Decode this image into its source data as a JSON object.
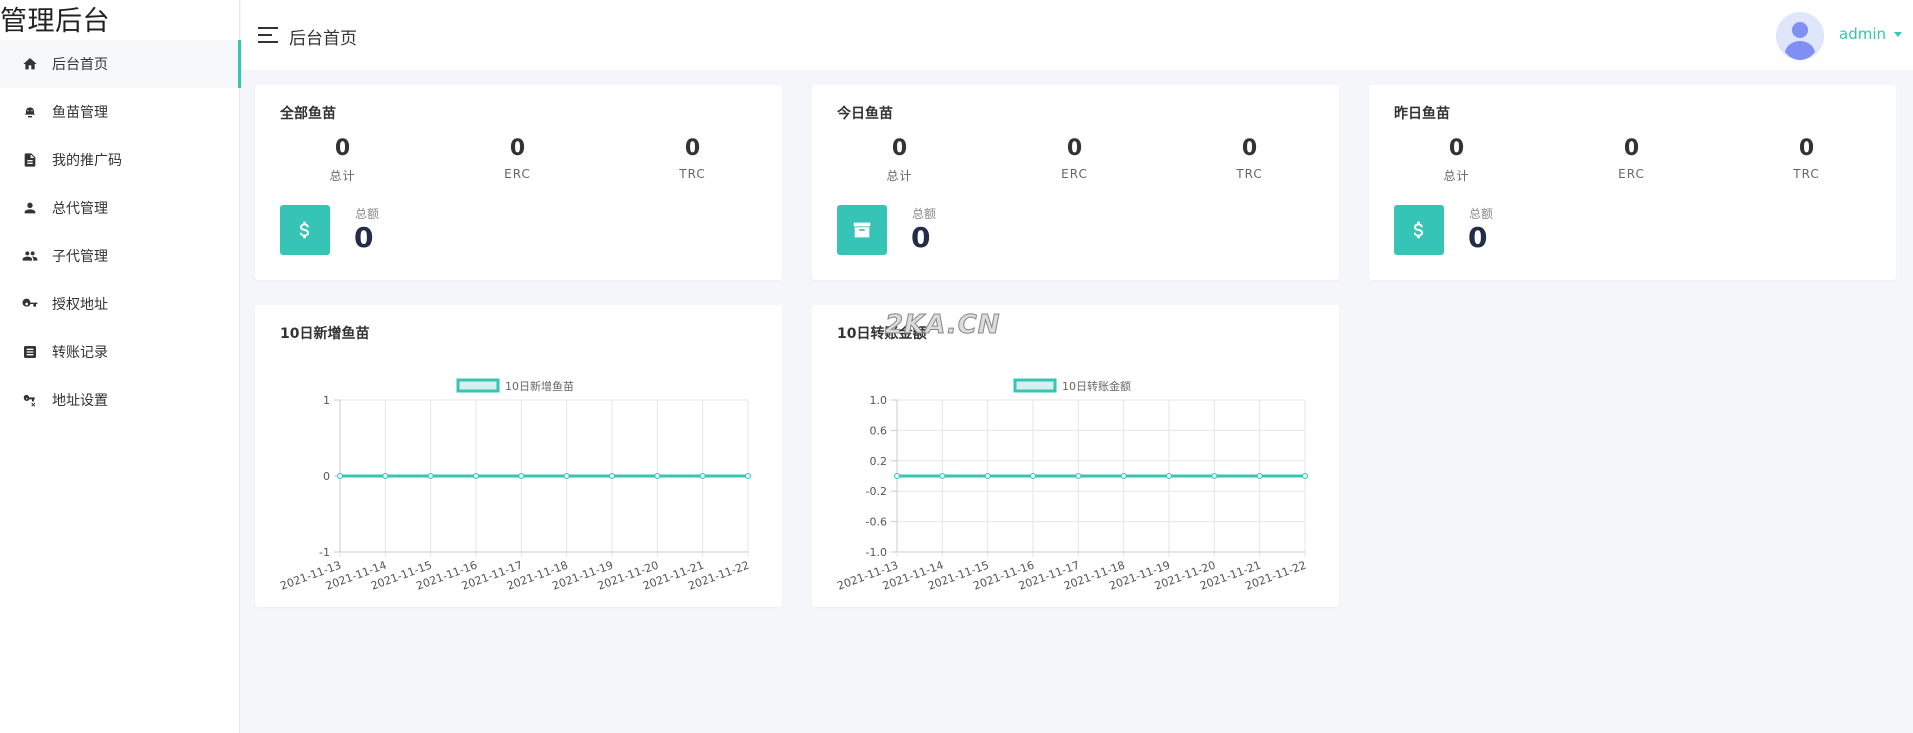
{
  "brand": "管理后台",
  "sidebar": {
    "items": [
      {
        "label": "后台首页",
        "icon": "home-icon",
        "active": true
      },
      {
        "label": "鱼苗管理",
        "icon": "fish-icon",
        "active": false
      },
      {
        "label": "我的推广码",
        "icon": "document-icon",
        "active": false
      },
      {
        "label": "总代管理",
        "icon": "person-icon",
        "active": false
      },
      {
        "label": "子代管理",
        "icon": "people-icon",
        "active": false
      },
      {
        "label": "授权地址",
        "icon": "key-icon",
        "active": false
      },
      {
        "label": "转账记录",
        "icon": "list-icon",
        "active": false
      },
      {
        "label": "地址设置",
        "icon": "key-settings-icon",
        "active": false
      }
    ]
  },
  "header": {
    "title": "后台首页",
    "user": "admin"
  },
  "accent": "#35c4b5",
  "stats": [
    {
      "title": "全部鱼苗",
      "cols": [
        {
          "value": "0",
          "label": "总计"
        },
        {
          "value": "0",
          "label": "ERC"
        },
        {
          "value": "0",
          "label": "TRC"
        }
      ],
      "icon": "dollar-icon",
      "total_label": "总额",
      "total_value": "0"
    },
    {
      "title": "今日鱼苗",
      "cols": [
        {
          "value": "0",
          "label": "总计"
        },
        {
          "value": "0",
          "label": "ERC"
        },
        {
          "value": "0",
          "label": "TRC"
        }
      ],
      "icon": "archive-icon",
      "total_label": "总额",
      "total_value": "0"
    },
    {
      "title": "昨日鱼苗",
      "cols": [
        {
          "value": "0",
          "label": "总计"
        },
        {
          "value": "0",
          "label": "ERC"
        },
        {
          "value": "0",
          "label": "TRC"
        }
      ],
      "icon": "dollar-icon",
      "total_label": "总额",
      "total_value": "0"
    }
  ],
  "watermark": "2KA.CN",
  "chart_data": [
    {
      "type": "line",
      "title": "10日新增鱼苗",
      "series": [
        {
          "name": "10日新增鱼苗",
          "values": [
            0,
            0,
            0,
            0,
            0,
            0,
            0,
            0,
            0,
            0
          ]
        }
      ],
      "x": [
        "2021-11-13",
        "2021-11-14",
        "2021-11-15",
        "2021-11-16",
        "2021-11-17",
        "2021-11-18",
        "2021-11-19",
        "2021-11-20",
        "2021-11-21",
        "2021-11-22"
      ],
      "yticks": [
        "1",
        "0",
        "-1"
      ],
      "ylim": [
        -1,
        1
      ],
      "grid": true,
      "legend": "top"
    },
    {
      "type": "line",
      "title": "10日转账金额",
      "series": [
        {
          "name": "10日转账金额",
          "values": [
            0,
            0,
            0,
            0,
            0,
            0,
            0,
            0,
            0,
            0
          ]
        }
      ],
      "x": [
        "2021-11-13",
        "2021-11-14",
        "2021-11-15",
        "2021-11-16",
        "2021-11-17",
        "2021-11-18",
        "2021-11-19",
        "2021-11-20",
        "2021-11-21",
        "2021-11-22"
      ],
      "yticks": [
        "1.0",
        "0.6",
        "0.2",
        "-0.2",
        "-0.6",
        "-1.0"
      ],
      "ylim": [
        -1,
        1
      ],
      "grid": true,
      "legend": "top"
    }
  ]
}
